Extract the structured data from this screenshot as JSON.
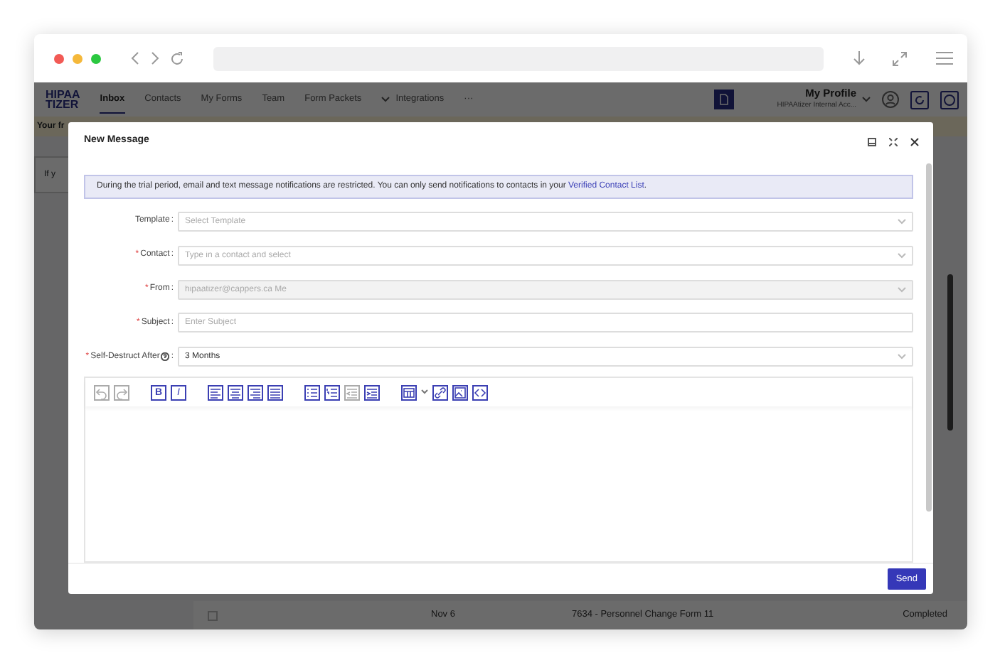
{
  "app": {
    "logo": [
      "HIPAA",
      "TIZER"
    ],
    "nav": [
      {
        "label": "Inbox",
        "selected": true
      },
      {
        "label": "Contacts",
        "selected": false
      },
      {
        "label": "My Forms",
        "selected": false
      },
      {
        "label": "Team",
        "selected": false
      },
      {
        "label": "Form Packets",
        "selected": false
      },
      {
        "label": "Integrations",
        "selected": false,
        "caret": true
      },
      {
        "label": "···",
        "selected": false
      }
    ],
    "profile": {
      "name": "My Profile",
      "account": "HIPAAtizer Internal Acc..."
    },
    "banner": "Your fr",
    "notice": "If y",
    "row": {
      "checked": false,
      "date": "Nov 6",
      "form": "7634 - Personnel Change Form 11",
      "status": "Completed"
    }
  },
  "dialog": {
    "title": "New Message",
    "alert": {
      "text": "During the trial period, email and text message notifications are restricted. You can only send notifications to contacts in your ",
      "link": "Verified Contact List",
      "end": "."
    },
    "fields": [
      {
        "label": "Template",
        "colon": ":",
        "kind": "select",
        "placeholder": "Select Template",
        "disabled": false
      },
      {
        "required_mark": "*",
        "label": "Contact",
        "colon": ":",
        "kind": "select",
        "placeholder": "Type in a contact and select",
        "disabled": false
      },
      {
        "required_mark": "*",
        "label": "From",
        "colon": ":",
        "kind": "select",
        "value": "hipaatizer@cappers.ca Me",
        "disabled": true
      },
      {
        "required_mark": "*",
        "label": "Subject",
        "colon": ":",
        "kind": "text",
        "placeholder": "Enter Subject",
        "disabled": false
      },
      {
        "required_mark": "*",
        "label": "Self-Destruct After",
        "colon": ":",
        "help": true,
        "kind": "select",
        "value": "3 Months",
        "disabled": false
      }
    ],
    "toolbar": [
      [
        {
          "kind": "undo",
          "disabled": true
        },
        {
          "kind": "redo",
          "disabled": true
        }
      ],
      [
        {
          "kind": "bold",
          "glyph": "B",
          "disabled": false
        },
        {
          "kind": "italic",
          "glyph": "I",
          "disabled": false
        }
      ],
      [
        {
          "kind": "align-left",
          "disabled": false
        },
        {
          "kind": "align-center",
          "disabled": false
        },
        {
          "kind": "align-right",
          "disabled": false
        },
        {
          "kind": "align-justify",
          "disabled": false
        }
      ],
      [
        {
          "kind": "bullet-list",
          "disabled": false
        },
        {
          "kind": "numbered-list",
          "disabled": false
        },
        {
          "kind": "outdent",
          "disabled": true
        },
        {
          "kind": "indent",
          "disabled": false
        }
      ],
      [
        {
          "kind": "table",
          "disabled": false,
          "caret": true
        },
        {
          "kind": "link",
          "disabled": false
        },
        {
          "kind": "image",
          "disabled": false
        },
        {
          "kind": "code",
          "disabled": false
        }
      ]
    ],
    "send": "Send"
  }
}
